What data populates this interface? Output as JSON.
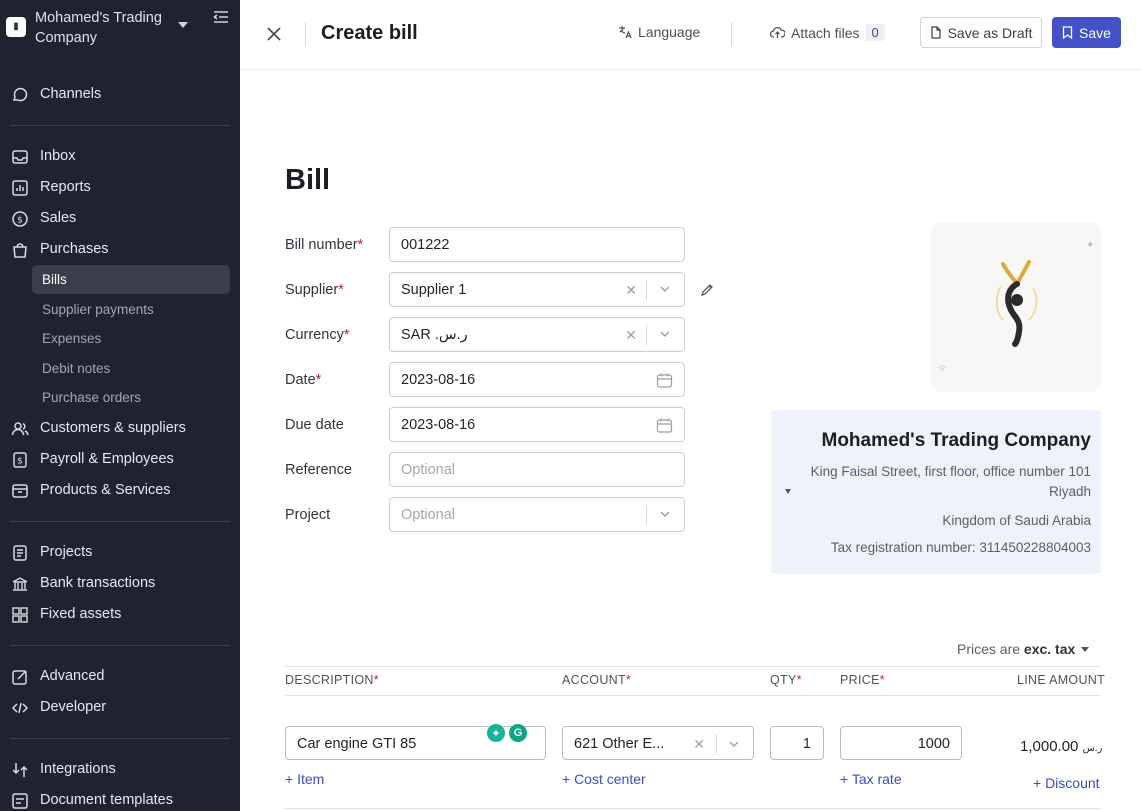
{
  "sidebar": {
    "company_name": "Mohamed's Trading Company",
    "channels": "Channels",
    "inbox": "Inbox",
    "reports": "Reports",
    "sales": "Sales",
    "purchases": "Purchases",
    "purchases_sub": [
      "Bills",
      "Supplier payments",
      "Expenses",
      "Debit notes",
      "Purchase orders"
    ],
    "customers_suppliers": "Customers & suppliers",
    "payroll": "Payroll & Employees",
    "products": "Products & Services",
    "projects": "Projects",
    "bank": "Bank transactions",
    "fixed_assets": "Fixed assets",
    "advanced": "Advanced",
    "developer": "Developer",
    "integrations": "Integrations",
    "document_templates": "Document templates"
  },
  "topbar": {
    "title": "Create bill",
    "language": "Language",
    "attach_files": "Attach files",
    "attach_count": "0",
    "save_draft": "Save as Draft",
    "save": "Save"
  },
  "form": {
    "heading": "Bill",
    "bill_number_label": "Bill number",
    "bill_number": "001222",
    "supplier_label": "Supplier",
    "supplier": "Supplier 1",
    "currency_label": "Currency",
    "currency": "SAR .ر.س",
    "date_label": "Date",
    "date": "2023-08-16",
    "due_date_label": "Due date",
    "due_date": "2023-08-16",
    "reference_label": "Reference",
    "reference_placeholder": "Optional",
    "project_label": "Project",
    "project_placeholder": "Optional",
    "required_mark": "*"
  },
  "company_card": {
    "name": "Mohamed's Trading Company",
    "address": "King Faisal Street, first floor, office number 101",
    "city": "Riyadh",
    "country": "Kingdom of Saudi Arabia",
    "tax": "Tax registration number: 311450228804003"
  },
  "prices": {
    "prefix": "Prices are",
    "mode": "exc. tax"
  },
  "table": {
    "headers": {
      "description": "DESCRIPTION",
      "account": "ACCOUNT",
      "qty": "QTY",
      "price": "PRICE",
      "line_amount": "LINE AMOUNT"
    },
    "row": {
      "description": "Car engine GTI 85",
      "account": "621 Other E...",
      "qty": "1",
      "price": "1000",
      "currency_symbol": "ر.س",
      "amount": "1,000.00"
    },
    "links": {
      "item": "+ Item",
      "cost_center": "+ Cost center",
      "tax_rate": "+ Tax rate",
      "discount": "+ Discount"
    }
  },
  "colors": {
    "sidebar_bg": "#1f2230",
    "primary": "#4451c9",
    "link": "#3a4bc4",
    "required": "#c2185b"
  }
}
